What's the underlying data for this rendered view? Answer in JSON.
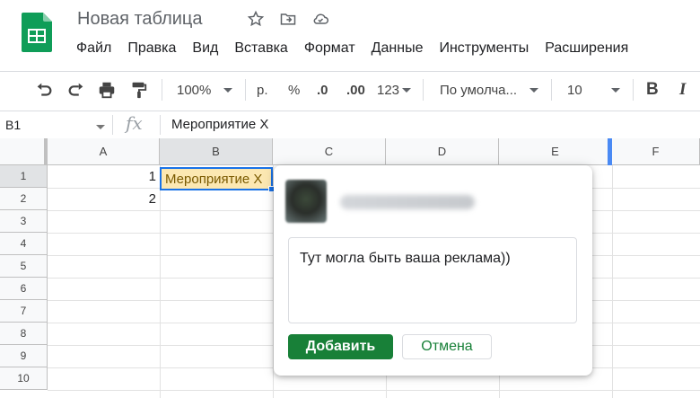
{
  "title_bar": {
    "doc_title": "Новая таблица",
    "icons": [
      "star-icon",
      "move-to-folder-icon",
      "cloud-status-icon"
    ]
  },
  "menu": [
    "Файл",
    "Правка",
    "Вид",
    "Вставка",
    "Формат",
    "Данные",
    "Инструменты",
    "Расширения"
  ],
  "toolbar": {
    "zoom": "100%",
    "currency": "р.",
    "percent": "%",
    "decrease_decimals": ".0",
    "increase_decimals": ".00",
    "more_formats": "123",
    "font": "По умолча...",
    "font_size": "10",
    "bold": "B",
    "italic": "I"
  },
  "formula_bar": {
    "cell_ref": "B1",
    "fx": "fx",
    "content": "Мероприятие Х"
  },
  "grid": {
    "columns": [
      "A",
      "B",
      "C",
      "D",
      "E",
      "F"
    ],
    "rows": [
      "1",
      "2",
      "3",
      "4",
      "5",
      "6",
      "7",
      "8",
      "9",
      "10"
    ],
    "cells": {
      "A1": "1",
      "A2": "2",
      "B1": "Мероприятие Х"
    }
  },
  "comment_popup": {
    "text": "Тут могла быть ваша реклама))",
    "add_label": "Добавить",
    "cancel_label": "Отмена"
  },
  "colors": {
    "accent": "#1a73e8",
    "brand_green": "#188038",
    "selected_cell_fill": "#fce8b2"
  }
}
